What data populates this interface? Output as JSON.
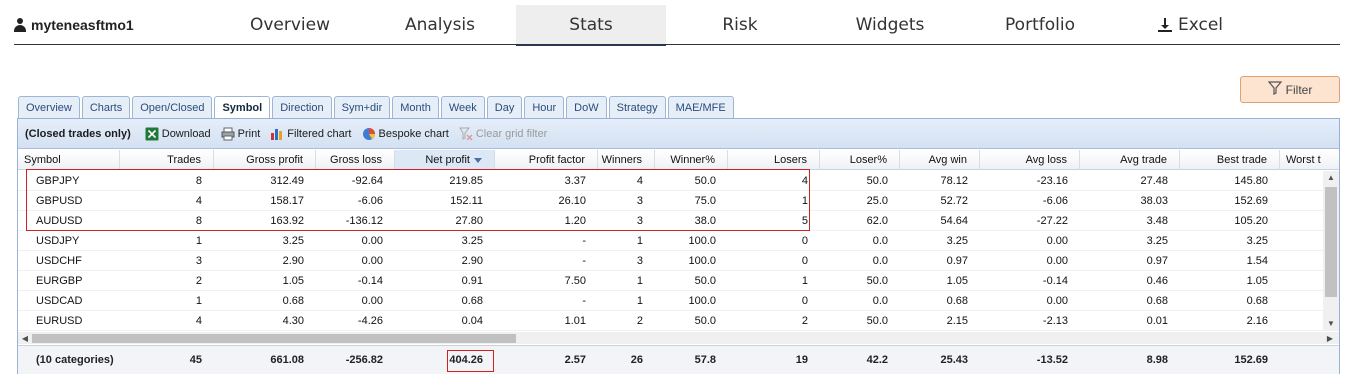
{
  "user": {
    "name": "myteneasftmo1"
  },
  "nav": {
    "tabs": [
      "Overview",
      "Analysis",
      "Stats",
      "Risk",
      "Widgets",
      "Portfolio",
      "Excel"
    ],
    "active": "Stats"
  },
  "filter": {
    "label": "Filter"
  },
  "subtabs": {
    "items": [
      "Overview",
      "Charts",
      "Open/Closed",
      "Symbol",
      "Direction",
      "Sym+dir",
      "Month",
      "Week",
      "Day",
      "Hour",
      "DoW",
      "Strategy",
      "MAE/MFE"
    ],
    "active": "Symbol"
  },
  "toolbar": {
    "scope_label": "(Closed trades only)",
    "download": "Download",
    "print": "Print",
    "filtered_chart": "Filtered chart",
    "bespoke_chart": "Bespoke chart",
    "clear_grid_filter": "Clear grid filter"
  },
  "grid": {
    "columns": [
      "Symbol",
      "Trades",
      "Gross profit",
      "Gross loss",
      "Net profit",
      "Profit factor",
      "Winners",
      "Winner%",
      "Losers",
      "Loser%",
      "Avg win",
      "Avg loss",
      "Avg trade",
      "Best trade",
      "Worst t"
    ],
    "sorted_column": "Net profit",
    "rows": [
      [
        "GBPJPY",
        "8",
        "312.49",
        "-92.64",
        "219.85",
        "3.37",
        "4",
        "50.0",
        "4",
        "50.0",
        "78.12",
        "-23.16",
        "27.48",
        "145.80"
      ],
      [
        "GBPUSD",
        "4",
        "158.17",
        "-6.06",
        "152.11",
        "26.10",
        "3",
        "75.0",
        "1",
        "25.0",
        "52.72",
        "-6.06",
        "38.03",
        "152.69"
      ],
      [
        "AUDUSD",
        "8",
        "163.92",
        "-136.12",
        "27.80",
        "1.20",
        "3",
        "38.0",
        "5",
        "62.0",
        "54.64",
        "-27.22",
        "3.48",
        "105.20"
      ],
      [
        "USDJPY",
        "1",
        "3.25",
        "0.00",
        "3.25",
        "-",
        "1",
        "100.0",
        "0",
        "0.0",
        "3.25",
        "0.00",
        "3.25",
        "3.25"
      ],
      [
        "USDCHF",
        "3",
        "2.90",
        "0.00",
        "2.90",
        "-",
        "3",
        "100.0",
        "0",
        "0.0",
        "0.97",
        "0.00",
        "0.97",
        "1.54"
      ],
      [
        "EURGBP",
        "2",
        "1.05",
        "-0.14",
        "0.91",
        "7.50",
        "1",
        "50.0",
        "1",
        "50.0",
        "1.05",
        "-0.14",
        "0.46",
        "1.05"
      ],
      [
        "USDCAD",
        "1",
        "0.68",
        "0.00",
        "0.68",
        "-",
        "1",
        "100.0",
        "0",
        "0.0",
        "0.68",
        "0.00",
        "0.68",
        "0.68"
      ],
      [
        "EURUSD",
        "4",
        "4.30",
        "-4.26",
        "0.04",
        "1.01",
        "2",
        "50.0",
        "2",
        "50.0",
        "2.15",
        "-2.13",
        "0.01",
        "2.16"
      ]
    ],
    "totals": [
      "(10 categories)",
      "45",
      "661.08",
      "-256.82",
      "404.26",
      "2.57",
      "26",
      "57.8",
      "19",
      "42.2",
      "25.43",
      "-13.52",
      "8.98",
      "152.69"
    ]
  }
}
